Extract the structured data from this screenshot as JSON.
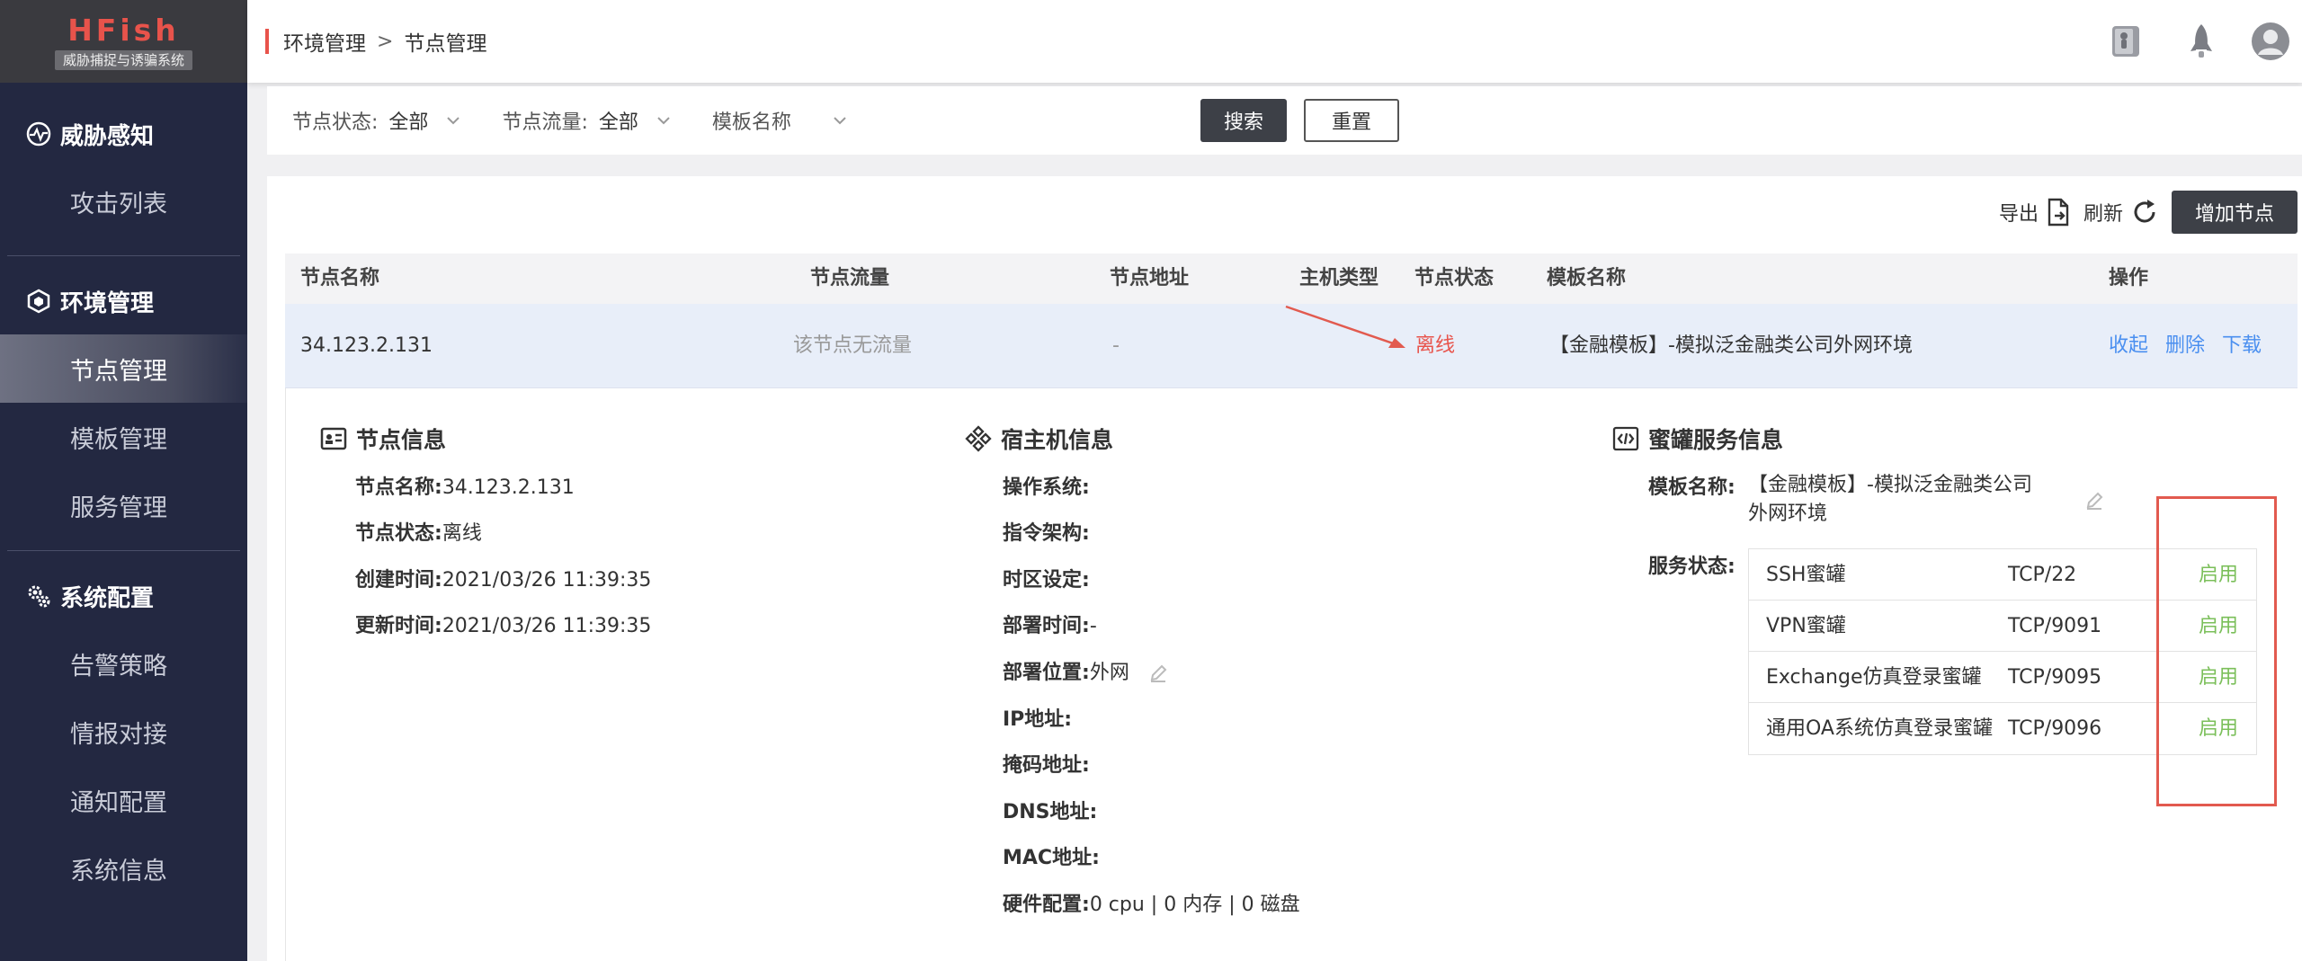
{
  "sidebar": {
    "logo_title": "HFish",
    "logo_subtitle": "威胁捕捉与诱骗系统",
    "groups": [
      {
        "label": "威胁感知",
        "icon": "pulse-icon",
        "items": [
          {
            "label": "攻击列表"
          }
        ]
      },
      {
        "label": "环境管理",
        "icon": "cube-icon",
        "items": [
          {
            "label": "节点管理"
          },
          {
            "label": "模板管理"
          },
          {
            "label": "服务管理"
          }
        ]
      },
      {
        "label": "系统配置",
        "icon": "gears-icon",
        "items": [
          {
            "label": "告警策略"
          },
          {
            "label": "情报对接"
          },
          {
            "label": "通知配置"
          },
          {
            "label": "系统信息"
          }
        ]
      }
    ],
    "active_item": "节点管理"
  },
  "header": {
    "breadcrumb": [
      "环境管理",
      "节点管理"
    ],
    "breadcrumb_separator": ">",
    "icons": [
      "book-icon",
      "rocket-icon",
      "user-avatar-icon"
    ]
  },
  "filters": {
    "status_label": "节点状态:",
    "status_value": "全部",
    "traffic_label": "节点流量:",
    "traffic_value": "全部",
    "template_placeholder": "模板名称",
    "search_button": "搜索",
    "reset_button": "重置"
  },
  "toolbar": {
    "export_label": "导出",
    "refresh_label": "刷新",
    "add_node_button": "增加节点"
  },
  "table": {
    "columns": [
      "节点名称",
      "节点流量",
      "节点地址",
      "主机类型",
      "节点状态",
      "模板名称",
      "操作"
    ],
    "rows": [
      {
        "name": "34.123.2.131",
        "traffic": "该节点无流量",
        "address": "-",
        "host_type": "",
        "status": "离线",
        "template": "【金融模板】-模拟泛金融类公司外网环境",
        "actions": [
          "收起",
          "删除",
          "下载"
        ]
      }
    ]
  },
  "detail": {
    "node_info": {
      "title": "节点信息",
      "fields": [
        {
          "label": "节点名称:",
          "value": "34.123.2.131"
        },
        {
          "label": "节点状态:",
          "value": "离线"
        },
        {
          "label": "创建时间:",
          "value": "2021/03/26 11:39:35"
        },
        {
          "label": "更新时间:",
          "value": "2021/03/26 11:39:35"
        }
      ]
    },
    "host_info": {
      "title": "宿主机信息",
      "fields": [
        {
          "label": "操作系统:",
          "value": ""
        },
        {
          "label": "指令架构:",
          "value": ""
        },
        {
          "label": "时区设定:",
          "value": ""
        },
        {
          "label": "部署时间:",
          "value": "-"
        },
        {
          "label": "部署位置:",
          "value": "外网"
        },
        {
          "label": "IP地址:",
          "value": ""
        },
        {
          "label": "掩码地址:",
          "value": ""
        },
        {
          "label": "DNS地址:",
          "value": ""
        },
        {
          "label": "MAC地址:",
          "value": ""
        },
        {
          "label": "硬件配置:",
          "value": "0 cpu | 0 内存 | 0 磁盘"
        }
      ]
    },
    "honeypot_info": {
      "title": "蜜罐服务信息",
      "template_label": "模板名称:",
      "template_value_line1": "【金融模板】-模拟泛金融类公司",
      "template_value_line2": "外网环境",
      "service_status_label": "服务状态:",
      "services": [
        {
          "name": "SSH蜜罐",
          "port": "TCP/22",
          "state": "启用"
        },
        {
          "name": "VPN蜜罐",
          "port": "TCP/9091",
          "state": "启用"
        },
        {
          "name": "Exchange仿真登录蜜罐",
          "port": "TCP/9095",
          "state": "启用"
        },
        {
          "name": "通用OA系统仿真登录蜜罐",
          "port": "TCP/9096",
          "state": "启用"
        }
      ]
    }
  },
  "colors": {
    "sidebar_bg": "#232841",
    "accent_red": "#e8534b",
    "link_blue": "#4a8ff0",
    "enable_green": "#7bbf5a",
    "row_highlight": "#e8eef9"
  }
}
